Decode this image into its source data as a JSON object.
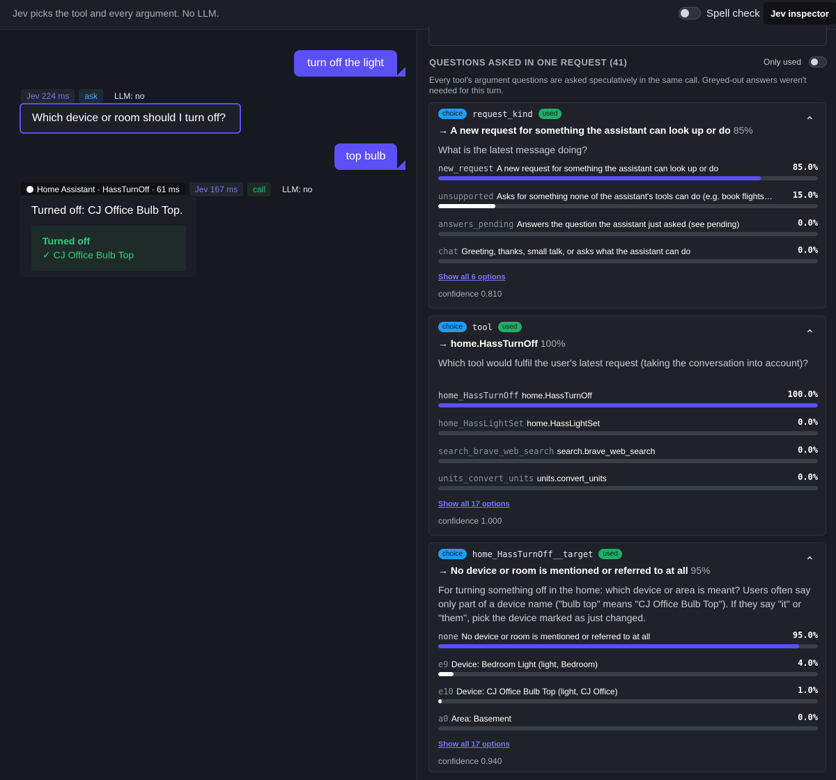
{
  "topbar": {
    "subtitle": "Jev picks the tool and every argument. No LLM.",
    "spell_check_label": "Spell check",
    "inspector_label": "Jev inspector"
  },
  "chat": {
    "user_msg_1": "turn off the light",
    "meta_1": {
      "jev": "Jev 224 ms",
      "kind": "ask",
      "llm": "LLM: no"
    },
    "assistant_question": "Which device or room should I turn off?",
    "user_msg_2": "top bulb",
    "meta_2": {
      "ha": "Home Assistant · HassTurnOff · 61 ms",
      "jev": "Jev 167 ms",
      "kind": "call",
      "llm": "LLM: no"
    },
    "assistant_reply": "Turned off: CJ Office Bulb Top.",
    "result_title": "Turned off",
    "result_item": "✓ CJ Office Bulb Top"
  },
  "inspector": {
    "title": "QUESTIONS ASKED IN ONE REQUEST (41)",
    "only_used_label": "Only used",
    "description": "Every tool's argument questions are asked speculatively in the same call. Greyed-out answers weren't needed for this turn.",
    "cards": [
      {
        "badge": "choice",
        "name": "request_kind",
        "used": "used",
        "answer": "→ A new request for something the assistant can look up or do",
        "answer_pct": "85%",
        "question": "What is the latest message doing?",
        "options": [
          {
            "code": "new_request",
            "desc": "A new request for something the assistant can look up or do",
            "value": "85.0%",
            "fraction": 0.85,
            "fill": "blue"
          },
          {
            "code": "unsupported",
            "desc": "Asks for something none of the assistant's tools can do (e.g. book flights…",
            "value": "15.0%",
            "fraction": 0.15,
            "fill": "white"
          },
          {
            "code": "answers_pending",
            "desc": "Answers the question the assistant just asked (see pending)",
            "value": "0.0%",
            "fraction": 0,
            "fill": "white"
          },
          {
            "code": "chat",
            "desc": "Greeting, thanks, small talk, or asks what the assistant can do",
            "value": "0.0%",
            "fraction": 0,
            "fill": "white"
          }
        ],
        "show_all": "Show all 6 options",
        "confidence": "confidence 0.810"
      },
      {
        "badge": "choice",
        "name": "tool",
        "used": "used",
        "answer": "→ home.HassTurnOff",
        "answer_pct": "100%",
        "question": "Which tool would fulfil the user's latest request (taking the conversation into account)?",
        "options": [
          {
            "code": "home_HassTurnOff",
            "desc": "home.HassTurnOff",
            "value": "100.0%",
            "fraction": 1.0,
            "fill": "blue"
          },
          {
            "code": "home_HassLightSet",
            "desc": "home.HassLightSet",
            "value": "0.0%",
            "fraction": 0,
            "fill": "white"
          },
          {
            "code": "search_brave_web_search",
            "desc": "search.brave_web_search",
            "value": "0.0%",
            "fraction": 0,
            "fill": "white"
          },
          {
            "code": "units_convert_units",
            "desc": "units.convert_units",
            "value": "0.0%",
            "fraction": 0,
            "fill": "white"
          }
        ],
        "show_all": "Show all 17 options",
        "confidence": "confidence 1.000"
      },
      {
        "badge": "choice",
        "name": "home_HassTurnOff__target",
        "used": "used",
        "answer": "→ No device or room is mentioned or referred to at all",
        "answer_pct": "95%",
        "question": "For turning something off in the home: which device or area is meant? Users often say only part of a device name (\"bulb top\" means \"CJ Office Bulb Top\"). If they say \"it\" or \"them\", pick the device marked as just changed.",
        "options": [
          {
            "code": "none",
            "desc": "No device or room is mentioned or referred to at all",
            "value": "95.0%",
            "fraction": 0.95,
            "fill": "blue"
          },
          {
            "code": "e9",
            "desc": "Device: Bedroom Light (light, Bedroom)",
            "value": "4.0%",
            "fraction": 0.04,
            "fill": "white"
          },
          {
            "code": "e10",
            "desc": "Device: CJ Office Bulb Top (light, CJ Office)",
            "value": "1.0%",
            "fraction": 0.01,
            "fill": "white"
          },
          {
            "code": "a0",
            "desc": "Area: Basement",
            "value": "0.0%",
            "fraction": 0,
            "fill": "white"
          }
        ],
        "show_all": "Show all 17 options",
        "confidence": "confidence 0.940"
      }
    ]
  }
}
